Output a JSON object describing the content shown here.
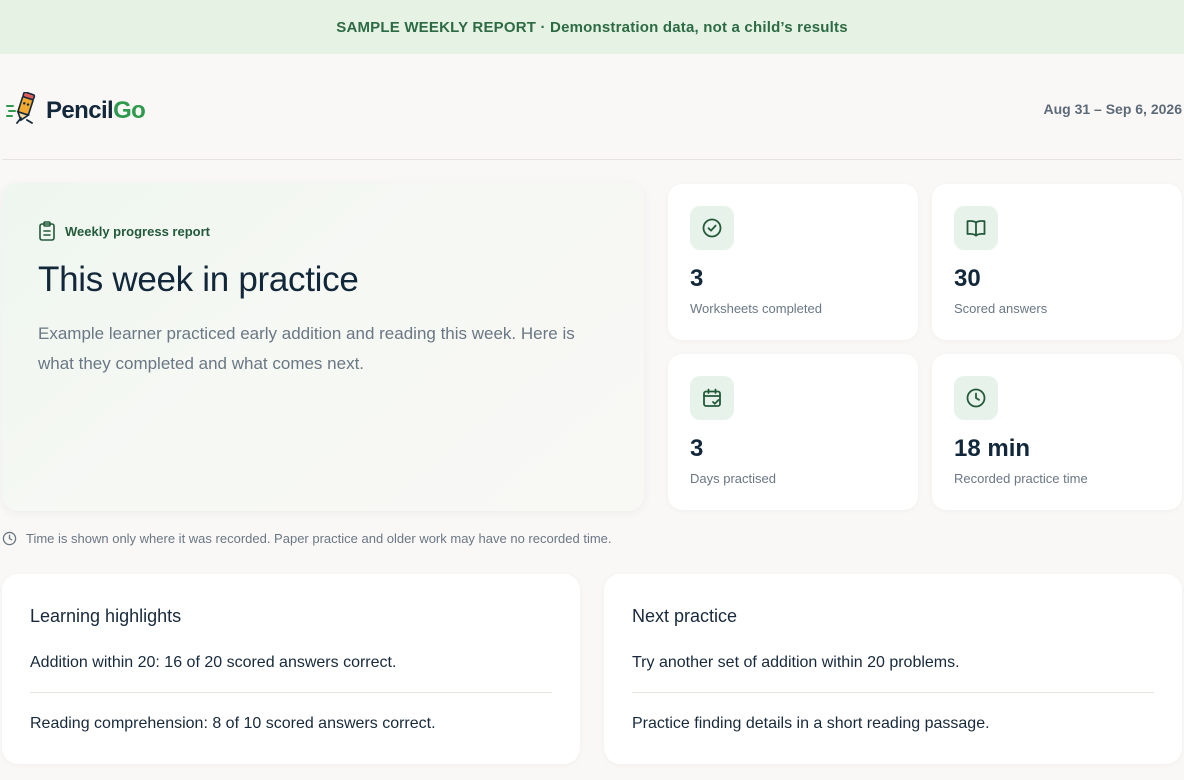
{
  "banner": {
    "text": "SAMPLE WEEKLY REPORT · Demonstration data, not a child’s results"
  },
  "header": {
    "logo_part1": "Pencil",
    "logo_part2": "Go",
    "date_range": "Aug 31 – Sep 6, 2026"
  },
  "hero": {
    "eyebrow": "Weekly progress report",
    "title": "This week in practice",
    "description": "Example learner practiced early addition and reading this week. Here is what they completed and what comes next."
  },
  "stats": [
    {
      "value": "3",
      "label": "Worksheets completed",
      "icon": "check-circle-icon"
    },
    {
      "value": "30",
      "label": "Scored answers",
      "icon": "open-book-icon"
    },
    {
      "value": "3",
      "label": "Days practised",
      "icon": "calendar-check-icon"
    },
    {
      "value": "18 min",
      "label": "Recorded practice time",
      "icon": "clock-icon"
    }
  ],
  "note": "Time is shown only where it was recorded. Paper practice and older work may have no recorded time.",
  "highlights": {
    "title": "Learning highlights",
    "items": [
      "Addition within 20: 16 of 20 scored answers correct.",
      "Reading comprehension: 8 of 10 scored answers correct."
    ]
  },
  "next": {
    "title": "Next practice",
    "items": [
      "Try another set of addition within 20 problems.",
      "Practice finding details in a short reading passage."
    ]
  },
  "colors": {
    "accent": "#2f9a4d",
    "banner_bg": "#e6f2e4",
    "banner_text": "#2c6b43",
    "icon_bg": "#e7f3ea",
    "text_dark": "#12283a",
    "text_muted": "#6a7784"
  }
}
